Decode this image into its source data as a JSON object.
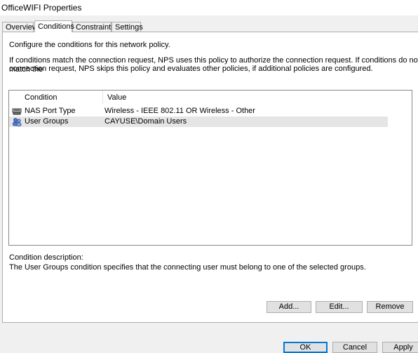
{
  "window": {
    "title": "OfficeWIFI Properties"
  },
  "tabs": [
    {
      "label": "Overview"
    },
    {
      "label": "Conditions"
    },
    {
      "label": "Constraints"
    },
    {
      "label": "Settings"
    }
  ],
  "active_tab": "Conditions",
  "conditions_page": {
    "intro": "Configure the conditions for this network policy.",
    "explanation_line1": "If conditions match the connection request, NPS uses this policy to authorize the connection request. If conditions do not match the",
    "explanation_line2": "connection request, NPS skips this policy and evaluates other policies, if additional policies are configured.",
    "table": {
      "columns": [
        "Condition",
        "Value"
      ],
      "rows": [
        {
          "condition": "NAS Port Type",
          "value": "Wireless - IEEE 802.11 OR Wireless - Other",
          "icon": "nas-port-icon",
          "selected": false
        },
        {
          "condition": "User Groups",
          "value": "CAYUSE\\Domain Users",
          "icon": "user-groups-icon",
          "selected": true
        }
      ]
    },
    "description_label": "Condition description:",
    "description_text": "The User Groups condition specifies that the connecting user must belong to one of the selected groups.",
    "buttons": {
      "add": "Add...",
      "edit": "Edit...",
      "remove": "Remove"
    }
  },
  "footer_buttons": {
    "ok": "OK",
    "cancel": "Cancel",
    "apply": "Apply"
  }
}
